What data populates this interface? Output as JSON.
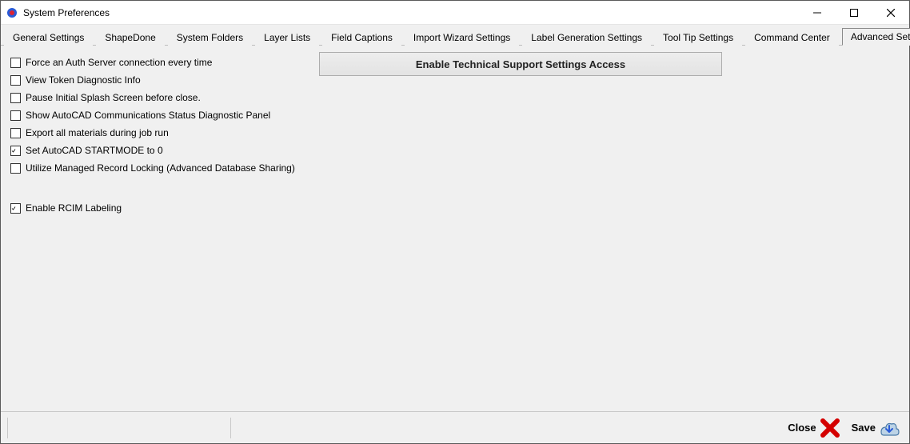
{
  "window": {
    "title": "System Preferences"
  },
  "tabs": [
    {
      "label": "General Settings"
    },
    {
      "label": "ShapeDone"
    },
    {
      "label": "System Folders"
    },
    {
      "label": "Layer Lists"
    },
    {
      "label": "Field Captions"
    },
    {
      "label": "Import Wizard Settings"
    },
    {
      "label": "Label Generation Settings"
    },
    {
      "label": "Tool Tip Settings"
    },
    {
      "label": "Command Center"
    },
    {
      "label": "Advanced Settings"
    }
  ],
  "active_tab_index": 9,
  "advanced": {
    "button_label": "Enable Technical Support Settings Access",
    "opts": [
      {
        "label": "Force an Auth Server connection every time",
        "checked": false
      },
      {
        "label": "View Token Diagnostic Info",
        "checked": false
      },
      {
        "label": "Pause Initial Splash Screen before close.",
        "checked": false
      },
      {
        "label": "Show AutoCAD Communications Status Diagnostic Panel",
        "checked": false
      },
      {
        "label": "Export all materials during job run",
        "checked": false
      },
      {
        "label": "Set AutoCAD STARTMODE to 0",
        "checked": true
      },
      {
        "label": "Utilize Managed Record Locking (Advanced Database Sharing)",
        "checked": false
      }
    ],
    "extra": {
      "label": "Enable RCIM Labeling",
      "checked": true
    }
  },
  "footer": {
    "close_label": "Close",
    "save_label": "Save"
  }
}
